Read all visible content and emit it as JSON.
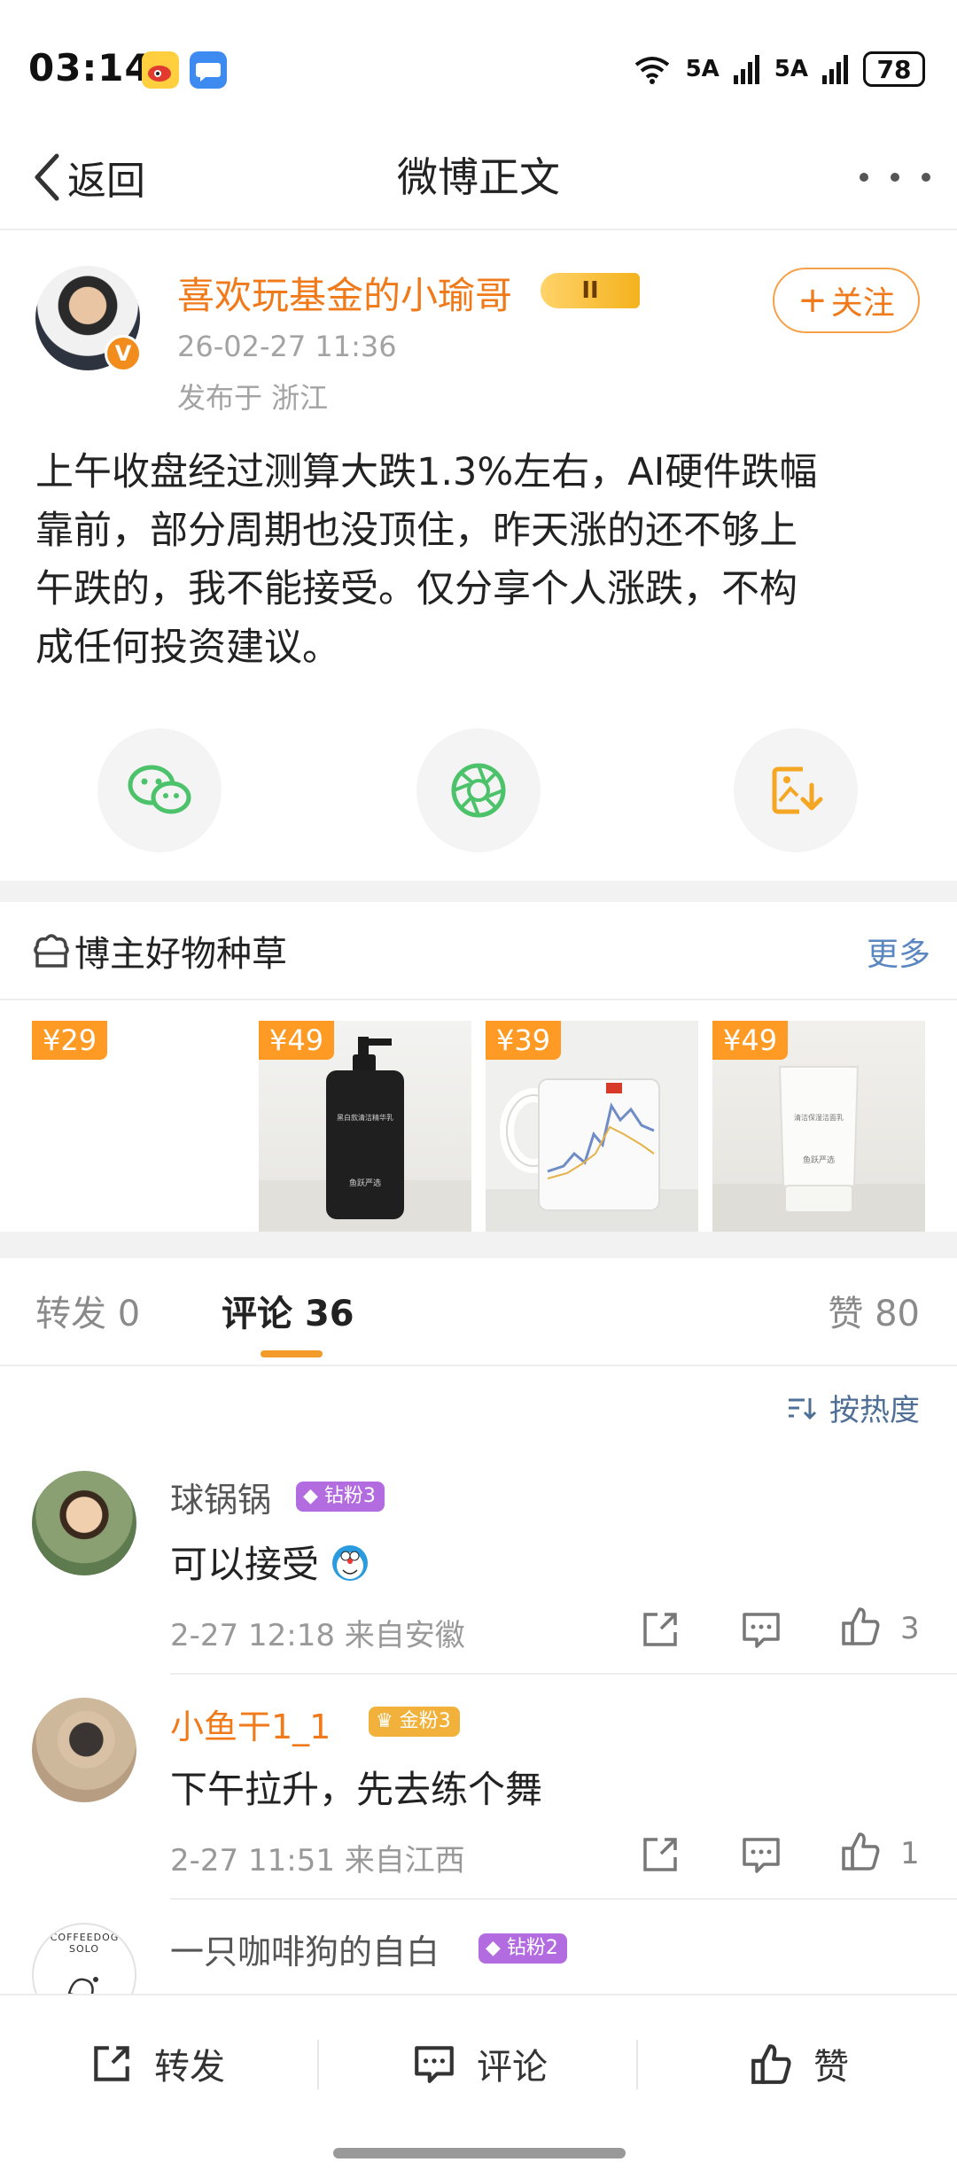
{
  "status_bar": {
    "time": "03:14",
    "signal_1": "5A",
    "signal_2": "5A",
    "battery": "78"
  },
  "nav": {
    "back_label": "返回",
    "title": "微博正文"
  },
  "post": {
    "author": "喜欢玩基金的小瑜哥",
    "level_badge": "II",
    "verified_mark": "V",
    "follow_label": "关注",
    "time": "26-02-27 11:36",
    "location": "发布于 浙江",
    "lines": [
      "上午收盘经过测算大跌1.3%左右，AI硬件跌幅",
      "靠前，部分周期也没顶住，昨天涨的还不够上",
      "午跌的，我不能接受。仅分享个人涨跌，不构",
      "成任何投资建议。"
    ]
  },
  "products": {
    "title": "博主好物种草",
    "more": "更多",
    "items": [
      {
        "price": "¥29"
      },
      {
        "price": "¥49",
        "label_top": "黑白款清洁精华乳",
        "label_bottom": "鱼跃严选"
      },
      {
        "price": "¥39"
      },
      {
        "price": "¥49",
        "label_top": "清洁保湿洁面乳",
        "label_bottom": "鱼跃严选"
      }
    ]
  },
  "tabs": {
    "repost": "转发 0",
    "comment_label": "评论",
    "comment_count": "36",
    "like": "赞 80"
  },
  "sort": {
    "label": "按热度"
  },
  "comments": [
    {
      "name": "球锅锅",
      "badge": "钻粉3",
      "text": "可以接受",
      "meta": "2-27 12:18 来自安徽",
      "likes": "3"
    },
    {
      "name": "小鱼干1_1",
      "badge": "金粉3",
      "text": "下午拉升，先去练个舞",
      "meta": "2-27 11:51 来自江西",
      "likes": "1"
    },
    {
      "name": "一只咖啡狗的自白",
      "badge": "钻粉2",
      "avatar_text": "A COFFEEDOG'S SOLO"
    }
  ],
  "bottom_bar": {
    "repost": "转发",
    "comment": "评论",
    "like": "赞"
  },
  "colors": {
    "accent_orange": "#f07a1a",
    "link_blue": "#5a87c0",
    "price_orange": "#ff9a24",
    "share_green": "#4cc26a"
  }
}
